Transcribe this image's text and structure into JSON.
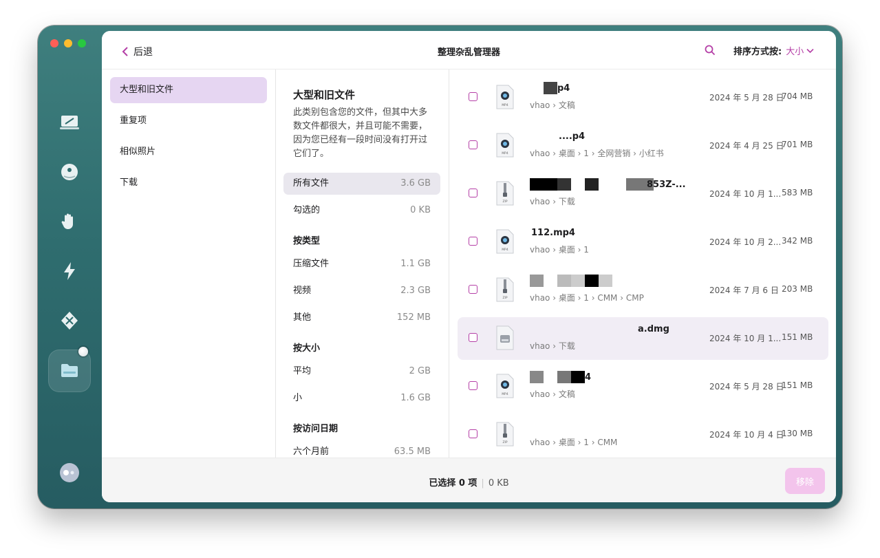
{
  "window_title": "整理杂乱管理器",
  "back_label": "后退",
  "sort": {
    "label": "排序方式按:",
    "value": "大小"
  },
  "categories": [
    {
      "label": "大型和旧文件",
      "active": true
    },
    {
      "label": "重复项"
    },
    {
      "label": "相似照片"
    },
    {
      "label": "下载"
    }
  ],
  "middle": {
    "heading": "大型和旧文件",
    "description": "此类别包含您的文件，但其中大多数文件都很大，并且可能不需要，因为您已经有一段时间没有打开过它们了。",
    "all_files": {
      "label": "所有文件",
      "size": "3.6 GB"
    },
    "checked": {
      "label": "勾选的",
      "size": "0 KB"
    },
    "by_type": "按类型",
    "types": [
      {
        "label": "压缩文件",
        "size": "1.1 GB"
      },
      {
        "label": "视频",
        "size": "2.3 GB"
      },
      {
        "label": "其他",
        "size": "152 MB"
      }
    ],
    "by_size": "按大小",
    "sizes": [
      {
        "label": "平均",
        "size": "2 GB"
      },
      {
        "label": "小",
        "size": "1.6 GB"
      }
    ],
    "by_access": "按访问日期",
    "access": [
      {
        "label": "六个月前",
        "size": "63.5 MB"
      }
    ]
  },
  "files": [
    {
      "name": "p4",
      "path": "vhao › 文稿",
      "date": "2024 年 5 月 28 日",
      "size": "704 MB",
      "icon": "mp4"
    },
    {
      "name": "....p4",
      "path": "vhao › 桌面 › 1 › 全网营销 › 小红书",
      "date": "2024 年 4 月 25 日",
      "size": "701 MB",
      "icon": "mp4"
    },
    {
      "name": "853Z-...",
      "path": "vhao › 下载",
      "date": "2024 年 10 月 1...",
      "size": "583 MB",
      "icon": "zip"
    },
    {
      "name": "112.mp4",
      "path": "vhao › 桌面 › 1",
      "date": "2024 年 10 月 2...",
      "size": "342 MB",
      "icon": "mp4"
    },
    {
      "name": "",
      "path": "vhao › 桌面 › 1 › CMM › CMP",
      "date": "2024 年 7 月 6 日",
      "size": "203 MB",
      "icon": "zip"
    },
    {
      "name": "a.dmg",
      "path": "vhao › 下载",
      "date": "2024 年 10 月 1...",
      "size": "151 MB",
      "icon": "dmg"
    },
    {
      "name": "4",
      "path": "vhao › 文稿",
      "date": "2024 年 5 月 28 日",
      "size": "151 MB",
      "icon": "mp4"
    },
    {
      "name": "",
      "path": "vhao › 桌面 › 1 › CMM",
      "date": "2024 年 10 月 4 日",
      "size": "130 MB",
      "icon": "zip"
    }
  ],
  "footer": {
    "selected": "已选择 0 项",
    "selected_size": "0 KB",
    "remove_label": "移除"
  },
  "colors": {
    "accent": "#b43ea6",
    "sidebar": "#2f6d6f"
  }
}
